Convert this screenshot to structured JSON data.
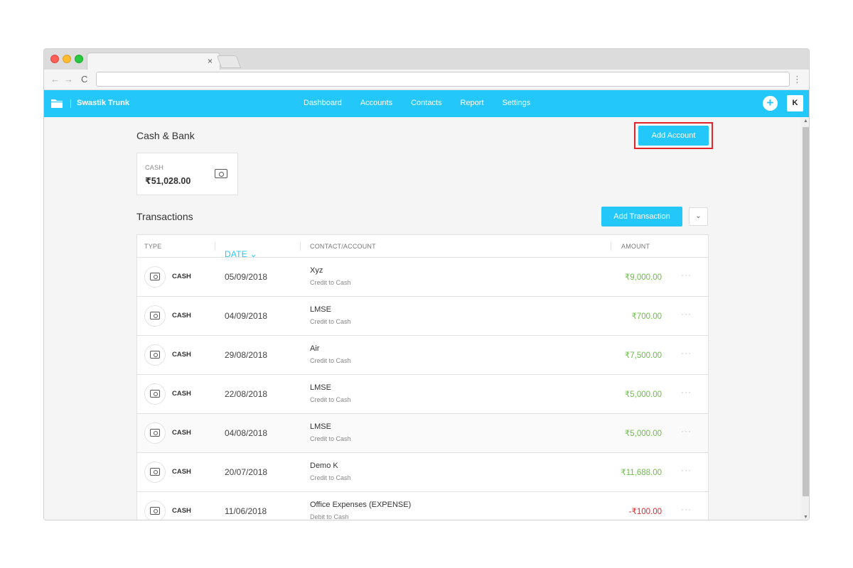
{
  "browser": {
    "tab_close": "×",
    "nav": {
      "back": "←",
      "forward": "→",
      "reload": "C",
      "menu": "⋮"
    }
  },
  "app": {
    "brand": "Swastik Trunk",
    "nav_items": [
      "Dashboard",
      "Accounts",
      "Contacts",
      "Report",
      "Settings"
    ],
    "plus_label": "+",
    "avatar_initial": "K",
    "brand_color": "#24c7fa"
  },
  "cash_bank": {
    "title": "Cash & Bank",
    "add_account_label": "Add Account",
    "card": {
      "label": "CASH",
      "amount": "₹51,028.00",
      "icon": "money-icon"
    }
  },
  "transactions": {
    "title": "Transactions",
    "add_transaction_label": "Add Transaction",
    "dropdown_icon": "⌄",
    "columns": {
      "type": "TYPE",
      "date": "DATE ⌄",
      "contact": "CONTACT/ACCOUNT",
      "amount": "AMOUNT"
    },
    "more_label": "···",
    "rows": [
      {
        "type": "CASH",
        "date": "05/09/2018",
        "contact": "Xyz",
        "sub": "Credit to Cash",
        "amount": "₹9,000.00",
        "kind": "credit"
      },
      {
        "type": "CASH",
        "date": "04/09/2018",
        "contact": "LMSE",
        "sub": "Credit to Cash",
        "amount": "₹700.00",
        "kind": "credit"
      },
      {
        "type": "CASH",
        "date": "29/08/2018",
        "contact": "Air",
        "sub": "Credit to Cash",
        "amount": "₹7,500.00",
        "kind": "credit"
      },
      {
        "type": "CASH",
        "date": "22/08/2018",
        "contact": "LMSE",
        "sub": "Credit to Cash",
        "amount": "₹5,000.00",
        "kind": "credit"
      },
      {
        "type": "CASH",
        "date": "04/08/2018",
        "contact": "LMSE",
        "sub": "Credit to Cash",
        "amount": "₹5,000.00",
        "kind": "credit"
      },
      {
        "type": "CASH",
        "date": "20/07/2018",
        "contact": "Demo K",
        "sub": "Credit to Cash",
        "amount": "₹11,688.00",
        "kind": "credit"
      },
      {
        "type": "CASH",
        "date": "11/06/2018",
        "contact": "Office Expenses (EXPENSE)",
        "sub": "Debit to Cash",
        "amount": "-₹100.00",
        "kind": "debit"
      }
    ]
  }
}
